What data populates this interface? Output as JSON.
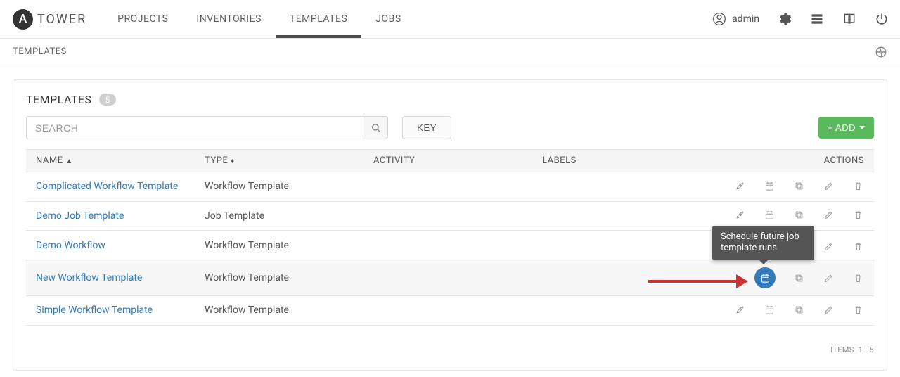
{
  "brand": {
    "logo_letter": "A",
    "name": "TOWER"
  },
  "nav": {
    "items": [
      "PROJECTS",
      "INVENTORIES",
      "TEMPLATES",
      "JOBS"
    ],
    "active": 2
  },
  "user": {
    "name": "admin"
  },
  "breadcrumb": "TEMPLATES",
  "panel": {
    "title": "TEMPLATES",
    "count": "5",
    "search_placeholder": "SEARCH",
    "key_button": "KEY",
    "add_button": "+ ADD"
  },
  "columns": {
    "name": "NAME",
    "type": "TYPE",
    "activity": "ACTIVITY",
    "labels": "LABELS",
    "actions": "ACTIONS"
  },
  "rows": [
    {
      "name": "Complicated Workflow Template",
      "type": "Workflow Template"
    },
    {
      "name": "Demo Job Template",
      "type": "Job Template"
    },
    {
      "name": "Demo Workflow",
      "type": "Workflow Template"
    },
    {
      "name": "New Workflow Template",
      "type": "Workflow Template"
    },
    {
      "name": "Simple Workflow Template",
      "type": "Workflow Template"
    }
  ],
  "tooltip": "Schedule future job template runs",
  "footer": {
    "items_label": "ITEMS",
    "range": "1 - 5"
  }
}
